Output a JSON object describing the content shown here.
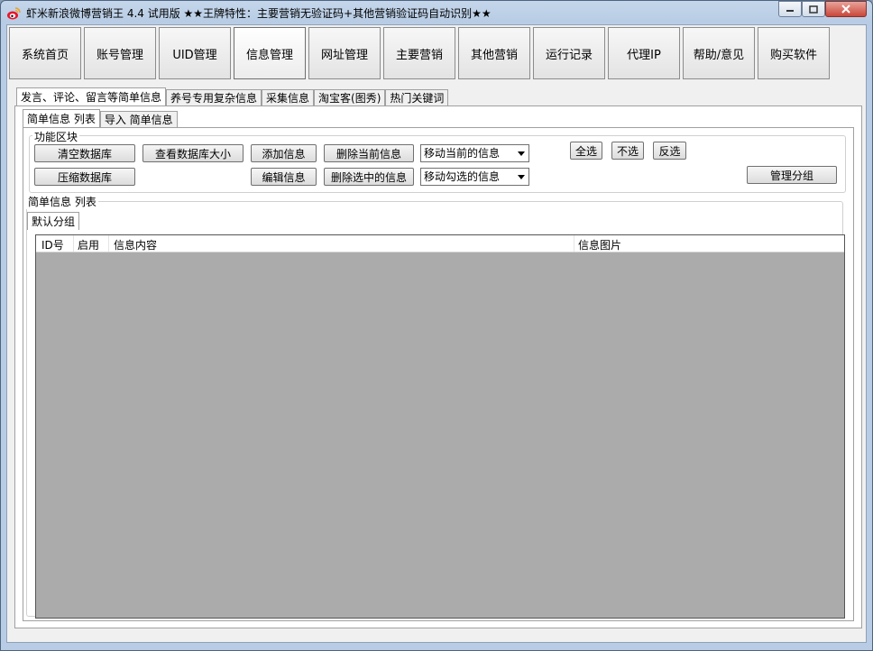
{
  "window": {
    "title": "虾米新浪微博营销王 4.4 试用版  ★★王牌特性：主要营销无验证码+其他营销验证码自动识别★★",
    "icon": "weibo-icon"
  },
  "main_nav": [
    {
      "label": "系统首页",
      "active": false
    },
    {
      "label": "账号管理",
      "active": false
    },
    {
      "label": "UID管理",
      "active": false
    },
    {
      "label": "信息管理",
      "active": true
    },
    {
      "label": "网址管理",
      "active": false
    },
    {
      "label": "主要营销",
      "active": false
    },
    {
      "label": "其他营销",
      "active": false
    },
    {
      "label": "运行记录",
      "active": false
    },
    {
      "label": "代理IP",
      "active": false
    },
    {
      "label": "帮助/意见",
      "active": false
    },
    {
      "label": "购买软件",
      "active": false
    }
  ],
  "top_tabs": [
    {
      "label": "发言、评论、留言等简单信息",
      "selected": true
    },
    {
      "label": "养号专用复杂信息",
      "selected": false
    },
    {
      "label": "采集信息",
      "selected": false
    },
    {
      "label": "淘宝客(图秀)",
      "selected": false
    },
    {
      "label": "热门关键词",
      "selected": false
    }
  ],
  "sub_tabs": [
    {
      "label": "简单信息 列表",
      "selected": true
    },
    {
      "label": "导入 简单信息",
      "selected": false
    }
  ],
  "function_group": {
    "label": "功能区块",
    "clear_db": "清空数据库",
    "view_db_size": "查看数据库大小",
    "add_info": "添加信息",
    "delete_current": "删除当前信息",
    "move_current": "移动当前的信息",
    "select_all": "全选",
    "select_none": "不选",
    "invert_selection": "反选",
    "compress_db": "压缩数据库",
    "edit_info": "编辑信息",
    "delete_selected": "删除选中的信息",
    "move_checked": "移动勾选的信息",
    "manage_groups": "管理分组"
  },
  "list_group": {
    "label": "简单信息 列表",
    "group_tab": "默认分组",
    "columns": [
      "ID号",
      "启用",
      "信息内容",
      "信息图片"
    ],
    "rows": []
  }
}
